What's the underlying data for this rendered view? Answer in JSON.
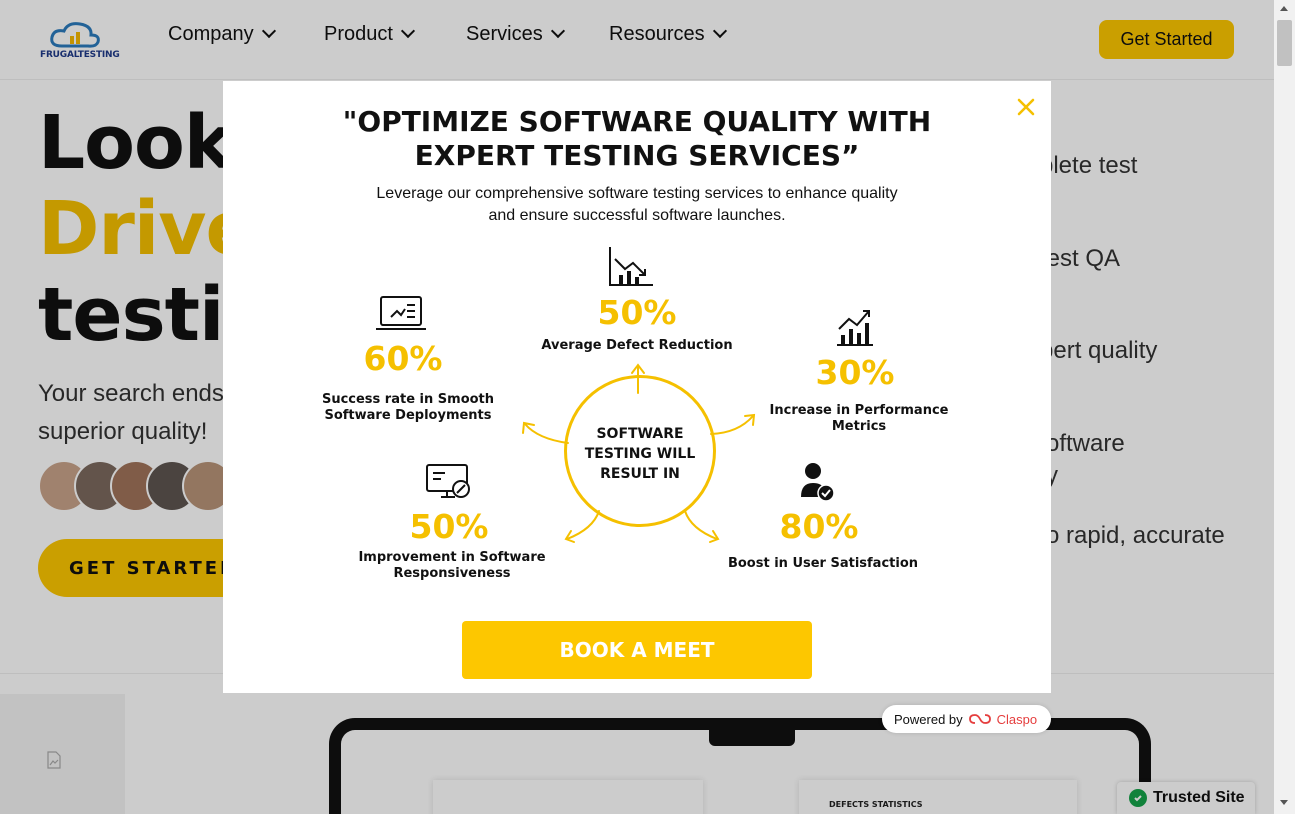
{
  "header": {
    "logo_text": "FRUGALTESTING",
    "nav": [
      {
        "label": "Company"
      },
      {
        "label": "Product"
      },
      {
        "label": "Services"
      },
      {
        "label": "Resources"
      }
    ],
    "cta_label": "Get Started"
  },
  "hero": {
    "line1": "Looki",
    "line2": "Drive",
    "line3": "testi",
    "sub1": "Your search ends",
    "sub2": "superior quality!",
    "cta_label": "GET STARTED"
  },
  "bullets": [
    "plete test",
    "test QA",
    "pert quality",
    "oftware",
    "y",
    "o rapid, accurate"
  ],
  "laptop": {
    "card2_title": "DEFECTS STATISTICS"
  },
  "modal": {
    "title_line1": "\"OPTIMIZE SOFTWARE QUALITY WITH",
    "title_line2": "EXPERT TESTING SERVICES”",
    "desc_line1": "Leverage our comprehensive software testing services to enhance quality",
    "desc_line2": "and ensure successful software launches.",
    "center_line1": "SOFTWARE",
    "center_line2": "TESTING WILL",
    "center_line3": "RESULT IN",
    "stats": [
      {
        "value": "50%",
        "label": "Average Defect Reduction",
        "icon": "chart-down-icon"
      },
      {
        "value": "60%",
        "label_line1": "Success rate in Smooth",
        "label_line2": "Software Deployments",
        "icon": "laptop-icon"
      },
      {
        "value": "30%",
        "label_line1": "Increase in Performance",
        "label_line2": "Metrics",
        "icon": "chart-up-icon"
      },
      {
        "value": "50%",
        "label_line1": "Improvement in Software",
        "label_line2": "Responsiveness",
        "icon": "monitor-tools-icon"
      },
      {
        "value": "80%",
        "label": "Boost in User Satisfaction",
        "icon": "user-check-icon"
      }
    ],
    "book_label": "BOOK A MEET"
  },
  "powered": {
    "prefix": "Powered by",
    "brand": "Claspo"
  },
  "trusted_label": "Trusted Site",
  "colors": {
    "accent": "#fdc700",
    "stat": "#f5c000",
    "close": "#f5c000",
    "trusted": "#16a34a",
    "claspo": "#e53e3e"
  }
}
